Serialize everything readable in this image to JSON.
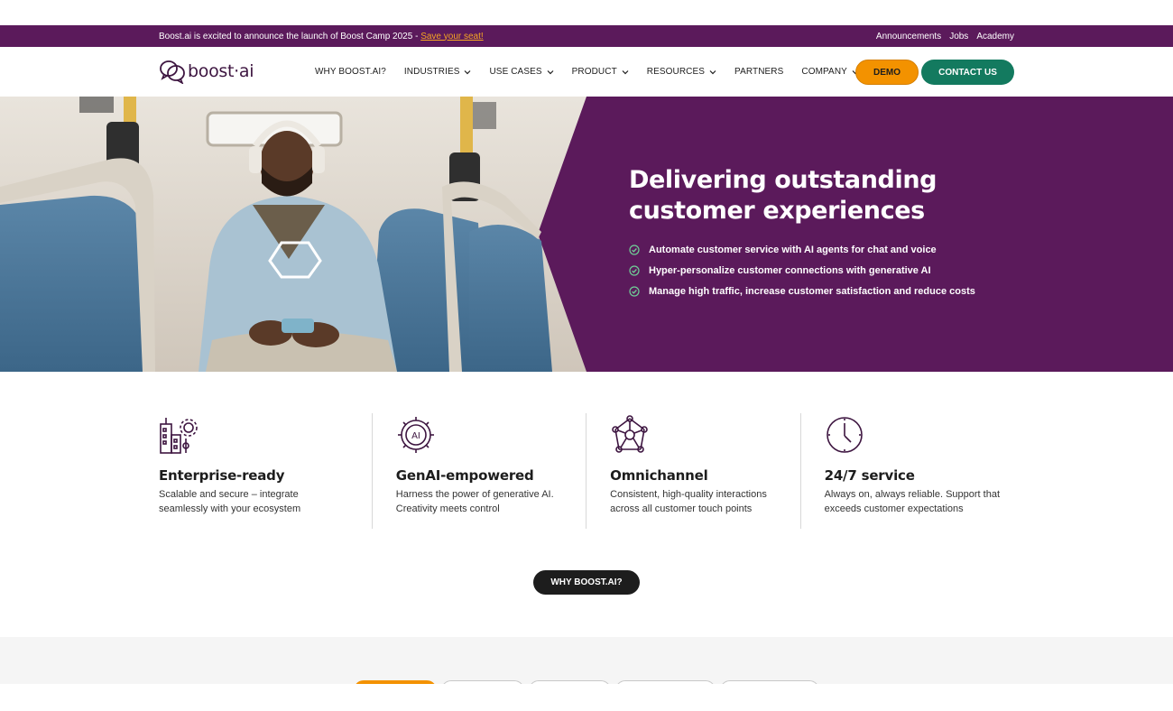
{
  "announcement": {
    "text": "Boost.ai is excited to announce the launch of Boost Camp 2025 - ",
    "link": "Save your seat!",
    "links": [
      "Announcements",
      "Jobs",
      "Academy"
    ]
  },
  "header": {
    "logo_text": "boost·ai",
    "nav": [
      {
        "label": "WHY BOOST.AI?",
        "dropdown": false
      },
      {
        "label": "INDUSTRIES",
        "dropdown": true
      },
      {
        "label": "USE CASES",
        "dropdown": true
      },
      {
        "label": "PRODUCT",
        "dropdown": true
      },
      {
        "label": "RESOURCES",
        "dropdown": true
      },
      {
        "label": "PARTNERS",
        "dropdown": false
      },
      {
        "label": "COMPANY",
        "dropdown": true
      }
    ],
    "demo_label": "DEMO",
    "contact_label": "CONTACT US"
  },
  "hero": {
    "title": "Delivering outstanding customer experiences",
    "bullets": [
      "Automate customer service with AI agents for chat and voice",
      "Hyper-personalize customer connections with generative AI",
      "Manage high traffic, increase customer satisfaction and reduce costs"
    ]
  },
  "features": [
    {
      "icon": "enterprise-icon",
      "title": "Enterprise-ready",
      "text": "Scalable and secure – integrate seamlessly with your ecosystem"
    },
    {
      "icon": "ai-chip-icon",
      "title": "GenAI-empowered",
      "text": "Harness the power of generative AI. Creativity meets control"
    },
    {
      "icon": "network-icon",
      "title": "Omnichannel",
      "text": "Consistent, high-quality interactions across all customer touch points"
    },
    {
      "icon": "clock-icon",
      "title": "24/7 service",
      "text": "Always on, always reliable. Support that exceeds customer expectations"
    }
  ],
  "why_button": "WHY BOOST.AI?",
  "colors": {
    "brand_purple": "#5b1a5b",
    "demo_orange": "#f39200",
    "contact_green": "#137a5f",
    "check_green": "#6fcf97"
  }
}
